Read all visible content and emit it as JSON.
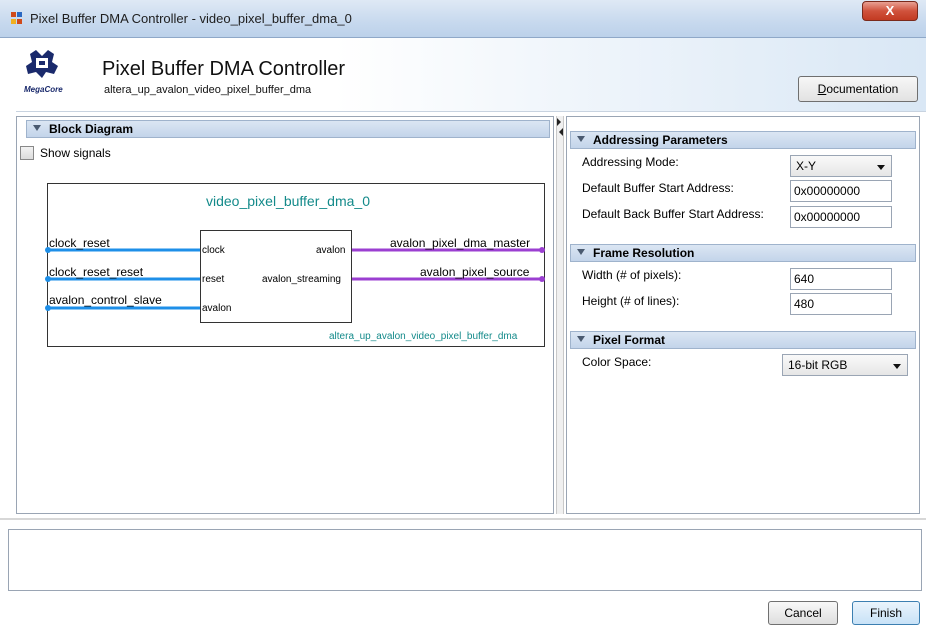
{
  "window": {
    "title": "Pixel Buffer DMA Controller - video_pixel_buffer_dma_0",
    "close_label": "X"
  },
  "header": {
    "title": "Pixel Buffer DMA Controller",
    "subtitle": "altera_up_avalon_video_pixel_buffer_dma",
    "logo_text": "MegaCore",
    "documentation_button": {
      "first": "D",
      "rest": "ocumentation"
    }
  },
  "block_diagram": {
    "header": "Block Diagram",
    "show_signals_label": "Show signals",
    "show_signals_checked": false,
    "instance_name": "video_pixel_buffer_dma_0",
    "component_name": "altera_up_avalon_video_pixel_buffer_dma",
    "left_ports": [
      {
        "interface": "clock_reset",
        "port": "clock"
      },
      {
        "interface": "clock_reset_reset",
        "port": "reset"
      },
      {
        "interface": "avalon_control_slave",
        "port": "avalon"
      }
    ],
    "right_ports": [
      {
        "interface": "avalon_pixel_dma_master",
        "port": "avalon"
      },
      {
        "interface": "avalon_pixel_source",
        "port": "avalon_streaming"
      }
    ],
    "colors": {
      "clock_line": "#1e8fe8",
      "avalon_line": "#9b3fd1",
      "component_text": "#138a8a"
    }
  },
  "parameters": {
    "addressing": {
      "header": "Addressing Parameters",
      "mode_label": "Addressing Mode:",
      "mode_value": "X-Y",
      "start_label": "Default Buffer Start Address:",
      "start_value": "0x00000000",
      "back_label": "Default Back Buffer Start Address:",
      "back_value": "0x00000000"
    },
    "frame": {
      "header": "Frame Resolution",
      "width_label": "Width (# of pixels):",
      "width_value": "640",
      "height_label": "Height (# of lines):",
      "height_value": "480"
    },
    "pixel": {
      "header": "Pixel Format",
      "color_space_label": "Color Space:",
      "color_space_value": "16-bit RGB"
    }
  },
  "footer": {
    "cancel": "Cancel",
    "finish": "Finish"
  }
}
